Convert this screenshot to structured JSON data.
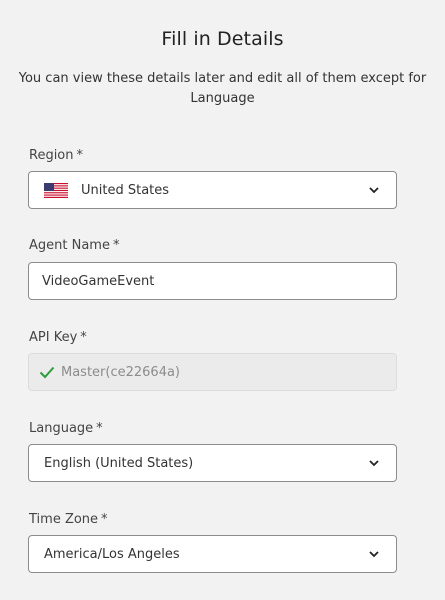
{
  "header": {
    "title": "Fill in Details",
    "subtitle": "You can view these details later and edit all of them except for Language"
  },
  "form": {
    "region": {
      "label": "Region",
      "required_mark": "*",
      "value": "United States",
      "flag_icon": "us-flag-icon"
    },
    "agent_name": {
      "label": "Agent Name",
      "required_mark": "*",
      "value": "VideoGameEvent"
    },
    "api_key": {
      "label": "API Key",
      "required_mark": "*",
      "value": "Master(ce22664a)",
      "status_icon": "check-icon",
      "status_color": "#2e9c3a"
    },
    "language": {
      "label": "Language",
      "required_mark": "*",
      "value": "English (United States)"
    },
    "time_zone": {
      "label": "Time Zone",
      "required_mark": "*",
      "value": "America/Los Angeles"
    }
  },
  "colors": {
    "background": "#f2f2f2",
    "field_border": "#8c8c8c",
    "disabled_bg": "#ebebeb",
    "check_green": "#2e9c3a"
  }
}
